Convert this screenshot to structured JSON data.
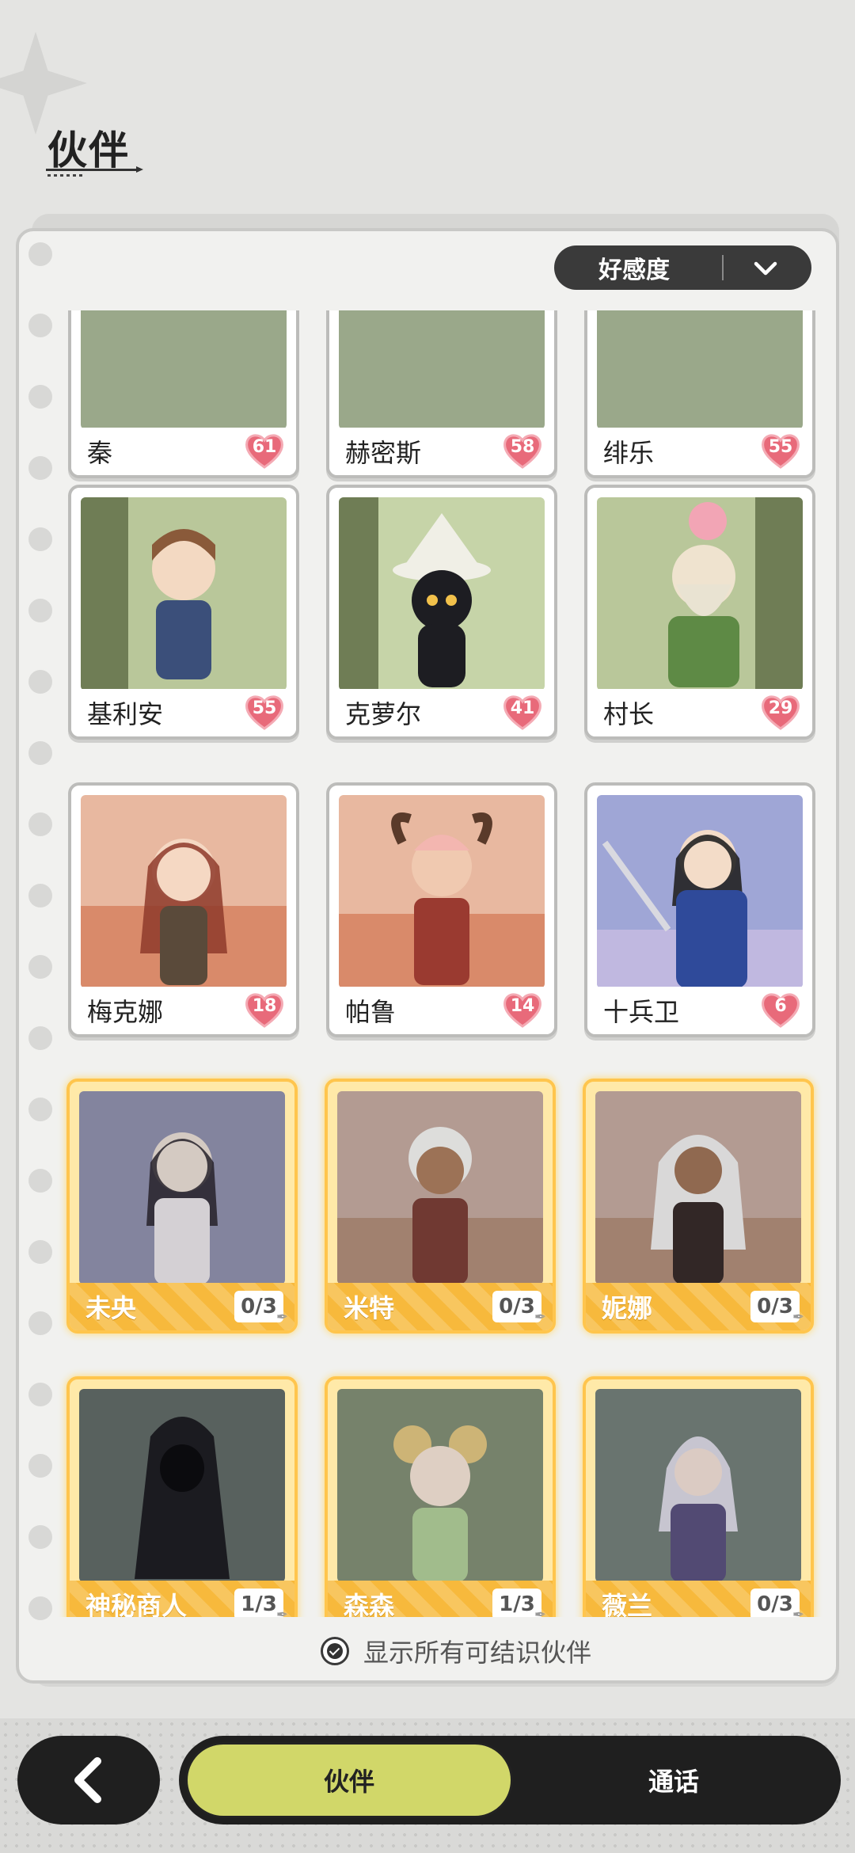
{
  "header": {
    "title": "伙伴"
  },
  "sort": {
    "label": "好感度"
  },
  "partners_known": [
    {
      "name": "秦",
      "affinity": "61"
    },
    {
      "name": "赫密斯",
      "affinity": "58"
    },
    {
      "name": "绯乐",
      "affinity": "55"
    },
    {
      "name": "基利安",
      "affinity": "55"
    },
    {
      "name": "克萝尔",
      "affinity": "41"
    },
    {
      "name": "村长",
      "affinity": "29"
    },
    {
      "name": "梅克娜",
      "affinity": "18"
    },
    {
      "name": "帕鲁",
      "affinity": "14"
    },
    {
      "name": "十兵卫",
      "affinity": "6"
    }
  ],
  "partners_unlockable": [
    {
      "name": "未央",
      "progress": "0/3"
    },
    {
      "name": "米特",
      "progress": "0/3"
    },
    {
      "name": "妮娜",
      "progress": "0/3"
    },
    {
      "name": "神秘商人",
      "progress": "1/3"
    },
    {
      "name": "森森",
      "progress": "1/3"
    },
    {
      "name": "薇兰",
      "progress": "0/3"
    }
  ],
  "footer": {
    "show_all_label": "显示所有可结识伙伴"
  },
  "tabs": {
    "partner": "伙伴",
    "call": "通话"
  },
  "colors": {
    "heart": "#e86a7a",
    "gold": "#f7b93c",
    "tab_active": "#d1d769"
  },
  "icons": {
    "back": "back-arrow-icon",
    "sort": "chevron-down-icon",
    "check": "check-circle-icon",
    "heart": "heart-icon"
  }
}
